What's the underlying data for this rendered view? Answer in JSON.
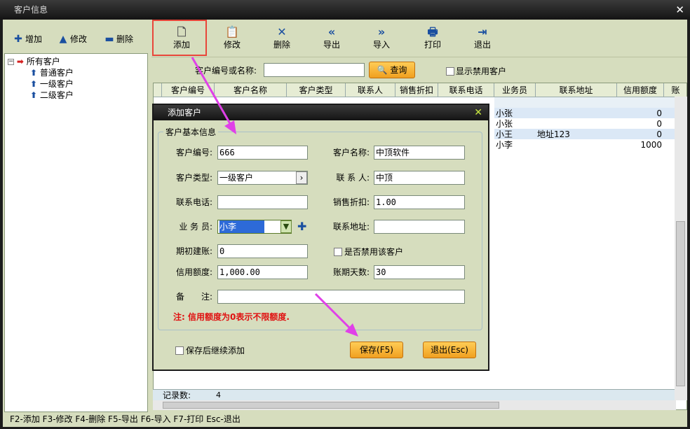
{
  "window": {
    "title": "客户信息",
    "close": "✕"
  },
  "left_toolbar": {
    "add": "增加",
    "edit": "修改",
    "delete": "删除"
  },
  "tree": {
    "root": "所有客户",
    "children": [
      "普通客户",
      "一级客户",
      "二级客户"
    ]
  },
  "toolbar": {
    "add": "添加",
    "edit": "修改",
    "delete": "删除",
    "export": "导出",
    "import": "导入",
    "print": "打印",
    "exit": "退出"
  },
  "search": {
    "label": "客户编号或名称:",
    "value": "",
    "button": "查询",
    "show_disabled": "显示禁用客户"
  },
  "grid": {
    "columns": [
      "客户编号",
      "客户名称",
      "客户类型",
      "联系人",
      "销售折扣",
      "联系电话",
      "业务员",
      "联系地址",
      "信用额度",
      "账"
    ],
    "rows": [
      {
        "salesman": "小张",
        "address": "",
        "credit": "0"
      },
      {
        "salesman": "小张",
        "address": "",
        "credit": "0"
      },
      {
        "salesman": "小王",
        "address": "地址123",
        "credit": "0"
      },
      {
        "salesman": "小李",
        "address": "",
        "credit": "1000"
      }
    ],
    "footer_label": "记录数:",
    "footer_count": "4"
  },
  "status": "F2-添加 F3-修改 F4-删除 F5-导出 F6-导入 F7-打印 Esc-退出",
  "dialog": {
    "title": "添加客户",
    "close": "✕",
    "group": "客户基本信息",
    "fields": {
      "code_label": "客户编号:",
      "code": "666",
      "name_label": "客户名称:",
      "name": "中顶软件",
      "type_label": "客户类型:",
      "type": "一级客户",
      "contact_label": "联 系 人:",
      "contact": "中顶",
      "phone_label": "联系电话:",
      "phone": "",
      "discount_label": "销售折扣:",
      "discount": "1.00",
      "salesman_label": "业 务 员:",
      "salesman": "小李",
      "address_label": "联系地址:",
      "address": "",
      "opening_label": "期初建账:",
      "opening": "0",
      "disable_label": "是否禁用该客户",
      "credit_label": "信用额度:",
      "credit": "1,000.00",
      "days_label": "账期天数:",
      "days": "30",
      "note_label": "备　　注:",
      "note": ""
    },
    "warning": "注: 信用额度为0表示不限额度.",
    "continue_label": "保存后继续添加",
    "save": "保存(F5)",
    "exit": "退出(Esc)"
  },
  "colors": {
    "accent_red": "#e8463a",
    "annotation_arrow": "#e040e8",
    "bg": "#d6ddbe"
  }
}
